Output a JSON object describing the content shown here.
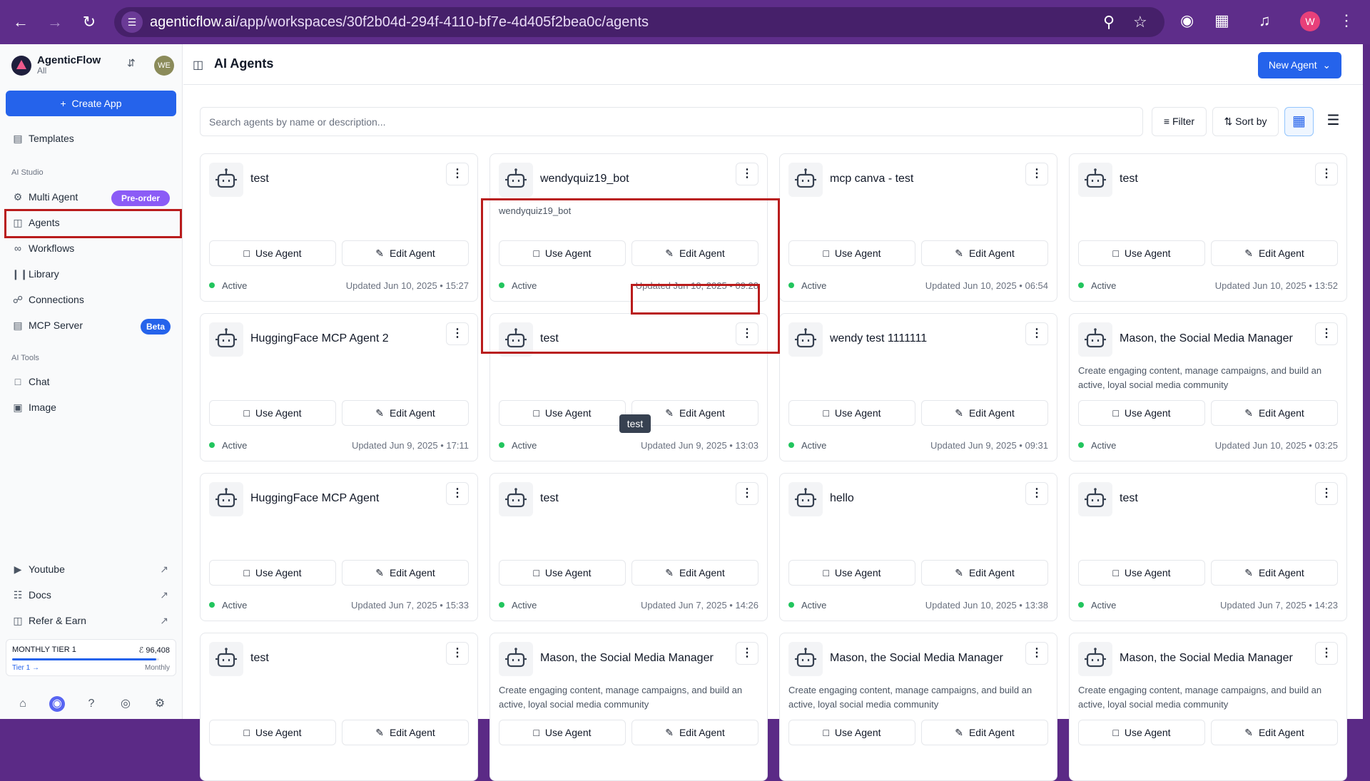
{
  "browser": {
    "url_domain": "agenticflow.ai",
    "url_path": "/app/workspaces/30f2b04d-294f-4110-bf7e-4d405f2bea0c/agents",
    "profile_initial": "W"
  },
  "workspace": {
    "name": "AgenticFlow",
    "sub": "All",
    "avatar": "WE"
  },
  "sidebar": {
    "create_label": "Create App",
    "templates": "Templates",
    "section_studio": "AI Studio",
    "multi_agent": "Multi Agent",
    "preorder_badge": "Pre-order",
    "agents": "Agents",
    "workflows": "Workflows",
    "library": "Library",
    "connections": "Connections",
    "mcp_server": "MCP Server",
    "beta_badge": "Beta",
    "section_tools": "AI Tools",
    "chat": "Chat",
    "image": "Image",
    "youtube": "Youtube",
    "docs": "Docs",
    "refer": "Refer & Earn",
    "tier": {
      "name": "MONTHLY TIER 1",
      "credits": "96,408",
      "usage_fraction": 0.98,
      "link": "Tier 1 →",
      "period": "Monthly"
    }
  },
  "header": {
    "title": "AI Agents",
    "new_agent": "New Agent"
  },
  "toolbar": {
    "search_placeholder": "Search agents by name or description...",
    "filter": "Filter",
    "sort": "Sort by"
  },
  "labels": {
    "use": "Use Agent",
    "edit": "Edit Agent",
    "status": "Active"
  },
  "tooltip": "test",
  "cards": [
    {
      "title": "test",
      "desc": "",
      "updated": "Updated Jun 10, 2025 • 15:27"
    },
    {
      "title": "wendyquiz19_bot",
      "desc": "wendyquiz19_bot",
      "updated": "Updated Jun 10, 2025 • 09:28"
    },
    {
      "title": "mcp canva - test",
      "desc": "",
      "updated": "Updated Jun 10, 2025 • 06:54"
    },
    {
      "title": "test",
      "desc": "",
      "updated": "Updated Jun 10, 2025 • 13:52"
    },
    {
      "title": "HuggingFace MCP Agent 2",
      "desc": "",
      "updated": "Updated Jun 9, 2025 • 17:11"
    },
    {
      "title": "test",
      "desc": "",
      "updated": "Updated Jun 9, 2025 • 13:03"
    },
    {
      "title": "wendy test 1111111",
      "desc": "",
      "updated": "Updated Jun 9, 2025 • 09:31"
    },
    {
      "title": "Mason, the Social Media Manager",
      "desc": "Create engaging content, manage campaigns, and build an active, loyal social media community",
      "updated": "Updated Jun 10, 2025 • 03:25"
    },
    {
      "title": "HuggingFace MCP Agent",
      "desc": "",
      "updated": "Updated Jun 7, 2025 • 15:33"
    },
    {
      "title": "test",
      "desc": "",
      "updated": "Updated Jun 7, 2025 • 14:26"
    },
    {
      "title": "hello",
      "desc": "",
      "updated": "Updated Jun 10, 2025 • 13:38"
    },
    {
      "title": "test",
      "desc": "",
      "updated": "Updated Jun 7, 2025 • 14:23"
    },
    {
      "title": "test",
      "desc": "",
      "updated": ""
    },
    {
      "title": "Mason, the Social Media Manager",
      "desc": "Create engaging content, manage campaigns, and build an active, loyal social media community",
      "updated": ""
    },
    {
      "title": "Mason, the Social Media Manager",
      "desc": "Create engaging content, manage campaigns, and build an active, loyal social media community",
      "updated": ""
    },
    {
      "title": "Mason, the Social Media Manager",
      "desc": "Create engaging content, manage campaigns, and build an active, loyal social media community",
      "updated": ""
    }
  ]
}
